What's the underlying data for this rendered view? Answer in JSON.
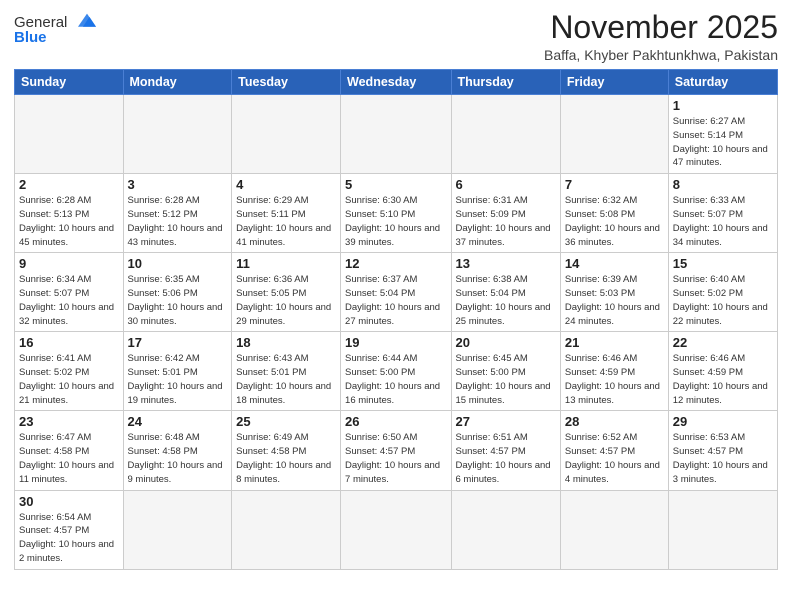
{
  "header": {
    "logo_line1": "General",
    "logo_line2": "Blue",
    "title": "November 2025",
    "subtitle": "Baffa, Khyber Pakhtunkhwa, Pakistan"
  },
  "weekdays": [
    "Sunday",
    "Monday",
    "Tuesday",
    "Wednesday",
    "Thursday",
    "Friday",
    "Saturday"
  ],
  "weeks": [
    [
      {
        "day": "",
        "info": ""
      },
      {
        "day": "",
        "info": ""
      },
      {
        "day": "",
        "info": ""
      },
      {
        "day": "",
        "info": ""
      },
      {
        "day": "",
        "info": ""
      },
      {
        "day": "",
        "info": ""
      },
      {
        "day": "1",
        "info": "Sunrise: 6:27 AM\nSunset: 5:14 PM\nDaylight: 10 hours and 47 minutes."
      }
    ],
    [
      {
        "day": "2",
        "info": "Sunrise: 6:28 AM\nSunset: 5:13 PM\nDaylight: 10 hours and 45 minutes."
      },
      {
        "day": "3",
        "info": "Sunrise: 6:28 AM\nSunset: 5:12 PM\nDaylight: 10 hours and 43 minutes."
      },
      {
        "day": "4",
        "info": "Sunrise: 6:29 AM\nSunset: 5:11 PM\nDaylight: 10 hours and 41 minutes."
      },
      {
        "day": "5",
        "info": "Sunrise: 6:30 AM\nSunset: 5:10 PM\nDaylight: 10 hours and 39 minutes."
      },
      {
        "day": "6",
        "info": "Sunrise: 6:31 AM\nSunset: 5:09 PM\nDaylight: 10 hours and 37 minutes."
      },
      {
        "day": "7",
        "info": "Sunrise: 6:32 AM\nSunset: 5:08 PM\nDaylight: 10 hours and 36 minutes."
      },
      {
        "day": "8",
        "info": "Sunrise: 6:33 AM\nSunset: 5:07 PM\nDaylight: 10 hours and 34 minutes."
      }
    ],
    [
      {
        "day": "9",
        "info": "Sunrise: 6:34 AM\nSunset: 5:07 PM\nDaylight: 10 hours and 32 minutes."
      },
      {
        "day": "10",
        "info": "Sunrise: 6:35 AM\nSunset: 5:06 PM\nDaylight: 10 hours and 30 minutes."
      },
      {
        "day": "11",
        "info": "Sunrise: 6:36 AM\nSunset: 5:05 PM\nDaylight: 10 hours and 29 minutes."
      },
      {
        "day": "12",
        "info": "Sunrise: 6:37 AM\nSunset: 5:04 PM\nDaylight: 10 hours and 27 minutes."
      },
      {
        "day": "13",
        "info": "Sunrise: 6:38 AM\nSunset: 5:04 PM\nDaylight: 10 hours and 25 minutes."
      },
      {
        "day": "14",
        "info": "Sunrise: 6:39 AM\nSunset: 5:03 PM\nDaylight: 10 hours and 24 minutes."
      },
      {
        "day": "15",
        "info": "Sunrise: 6:40 AM\nSunset: 5:02 PM\nDaylight: 10 hours and 22 minutes."
      }
    ],
    [
      {
        "day": "16",
        "info": "Sunrise: 6:41 AM\nSunset: 5:02 PM\nDaylight: 10 hours and 21 minutes."
      },
      {
        "day": "17",
        "info": "Sunrise: 6:42 AM\nSunset: 5:01 PM\nDaylight: 10 hours and 19 minutes."
      },
      {
        "day": "18",
        "info": "Sunrise: 6:43 AM\nSunset: 5:01 PM\nDaylight: 10 hours and 18 minutes."
      },
      {
        "day": "19",
        "info": "Sunrise: 6:44 AM\nSunset: 5:00 PM\nDaylight: 10 hours and 16 minutes."
      },
      {
        "day": "20",
        "info": "Sunrise: 6:45 AM\nSunset: 5:00 PM\nDaylight: 10 hours and 15 minutes."
      },
      {
        "day": "21",
        "info": "Sunrise: 6:46 AM\nSunset: 4:59 PM\nDaylight: 10 hours and 13 minutes."
      },
      {
        "day": "22",
        "info": "Sunrise: 6:46 AM\nSunset: 4:59 PM\nDaylight: 10 hours and 12 minutes."
      }
    ],
    [
      {
        "day": "23",
        "info": "Sunrise: 6:47 AM\nSunset: 4:58 PM\nDaylight: 10 hours and 11 minutes."
      },
      {
        "day": "24",
        "info": "Sunrise: 6:48 AM\nSunset: 4:58 PM\nDaylight: 10 hours and 9 minutes."
      },
      {
        "day": "25",
        "info": "Sunrise: 6:49 AM\nSunset: 4:58 PM\nDaylight: 10 hours and 8 minutes."
      },
      {
        "day": "26",
        "info": "Sunrise: 6:50 AM\nSunset: 4:57 PM\nDaylight: 10 hours and 7 minutes."
      },
      {
        "day": "27",
        "info": "Sunrise: 6:51 AM\nSunset: 4:57 PM\nDaylight: 10 hours and 6 minutes."
      },
      {
        "day": "28",
        "info": "Sunrise: 6:52 AM\nSunset: 4:57 PM\nDaylight: 10 hours and 4 minutes."
      },
      {
        "day": "29",
        "info": "Sunrise: 6:53 AM\nSunset: 4:57 PM\nDaylight: 10 hours and 3 minutes."
      }
    ],
    [
      {
        "day": "30",
        "info": "Sunrise: 6:54 AM\nSunset: 4:57 PM\nDaylight: 10 hours and 2 minutes."
      },
      {
        "day": "",
        "info": ""
      },
      {
        "day": "",
        "info": ""
      },
      {
        "day": "",
        "info": ""
      },
      {
        "day": "",
        "info": ""
      },
      {
        "day": "",
        "info": ""
      },
      {
        "day": "",
        "info": ""
      }
    ]
  ]
}
